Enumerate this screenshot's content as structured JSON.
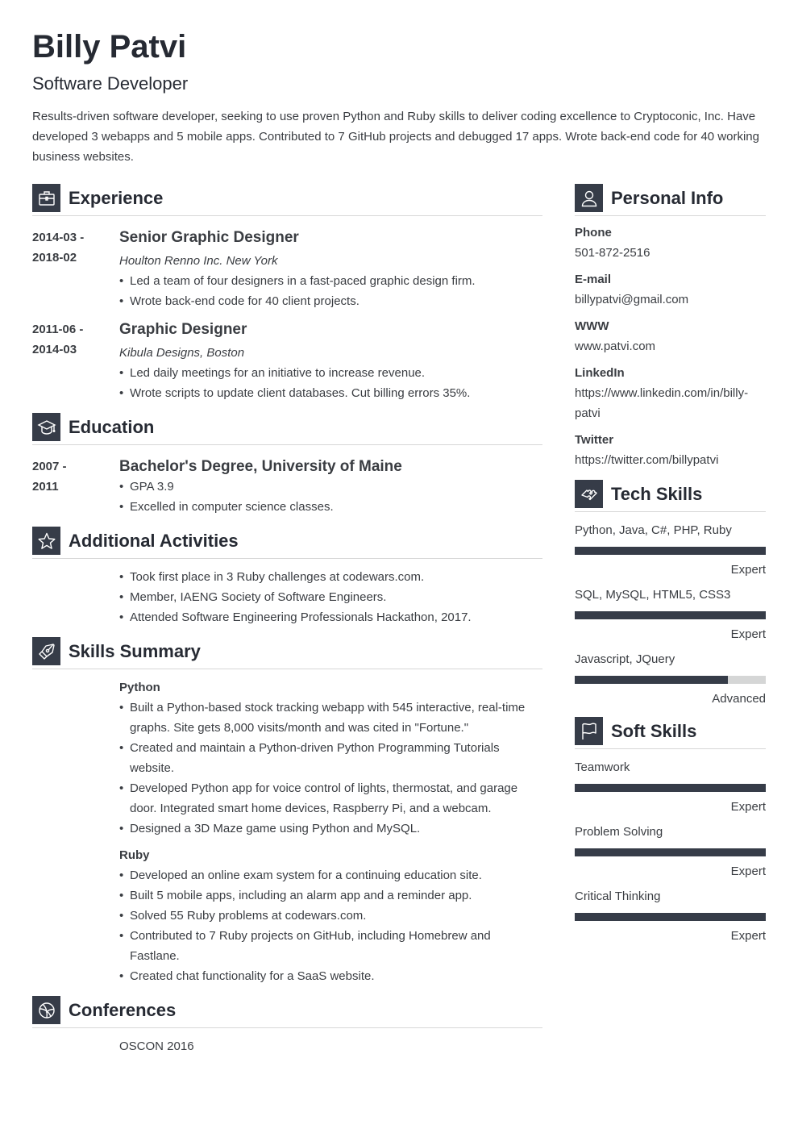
{
  "header": {
    "name": "Billy Patvi",
    "title": "Software Developer",
    "summary": "Results-driven software developer, seeking to use proven Python and Ruby skills to deliver coding excellence to Cryptoconic, Inc. Have developed 3 webapps and 5 mobile apps. Contributed to 7 GitHub projects and debugged 17 apps. Wrote back-end code for 40 working business websites."
  },
  "experience": {
    "heading": "Experience",
    "icon": "briefcase-icon",
    "entries": [
      {
        "date_start": "2014-03 -",
        "date_end": "2018-02",
        "title": "Senior Graphic Designer",
        "company": "Houlton Renno Inc. New York",
        "bullets": [
          "Led a team of four designers in a fast-paced graphic design firm.",
          "Wrote back-end code for 40 client projects."
        ]
      },
      {
        "date_start": "2011-06 -",
        "date_end": "2014-03",
        "title": "Graphic Designer",
        "company": "Kibula Designs, Boston",
        "bullets": [
          "Led daily meetings for an initiative to increase revenue.",
          "Wrote scripts to update client databases. Cut billing errors 35%."
        ]
      }
    ]
  },
  "education": {
    "heading": "Education",
    "icon": "graduation-cap-icon",
    "entries": [
      {
        "date_start": "2007 -",
        "date_end": "2011",
        "title": "Bachelor's Degree, University of Maine",
        "bullets": [
          "GPA 3.9",
          "Excelled in computer science classes."
        ]
      }
    ]
  },
  "activities": {
    "heading": "Additional Activities",
    "icon": "star-icon",
    "bullets": [
      "Took first place in 3 Ruby challenges at codewars.com.",
      "Member, IAENG Society of Software Engineers.",
      "Attended Software Engineering Professionals Hackathon, 2017."
    ]
  },
  "skills_summary": {
    "heading": "Skills Summary",
    "icon": "pen-nib-icon",
    "groups": [
      {
        "name": "Python",
        "bullets": [
          "Built a Python-based stock tracking webapp with 545 interactive, real-time graphs. Site gets 8,000 visits/month and was cited in \"Fortune.\"",
          "Created and maintain a Python-driven Python Programming Tutorials website.",
          "Developed Python app for voice control of lights, thermostat, and garage door. Integrated smart home devices, Raspberry Pi, and a webcam.",
          "Designed a 3D Maze game using Python and MySQL."
        ]
      },
      {
        "name": "Ruby",
        "bullets": [
          "Developed an online exam system for a continuing education site.",
          "Built 5 mobile apps, including an alarm app and a reminder app.",
          "Solved 55 Ruby problems at codewars.com.",
          "Contributed to 7 Ruby projects on GitHub, including Homebrew and Fastlane.",
          "Created chat functionality for a SaaS website."
        ]
      }
    ]
  },
  "conferences": {
    "heading": "Conferences",
    "icon": "basketball-icon",
    "items": [
      "OSCON 2016"
    ]
  },
  "personal_info": {
    "heading": "Personal Info",
    "icon": "user-icon",
    "fields": [
      {
        "label": "Phone",
        "value": "501-872-2516"
      },
      {
        "label": "E-mail",
        "value": "billypatvi@gmail.com"
      },
      {
        "label": "WWW",
        "value": "www.patvi.com"
      },
      {
        "label": "LinkedIn",
        "value": "https://www.linkedin.com/in/billy-patvi"
      },
      {
        "label": "Twitter",
        "value": "https://twitter.com/billypatvi"
      }
    ]
  },
  "tech_skills": {
    "heading": "Tech Skills",
    "icon": "puzzle-icon",
    "items": [
      {
        "name": "Python, Java, C#, PHP, Ruby",
        "level": "Expert",
        "fill": 1.0
      },
      {
        "name": "SQL, MySQL, HTML5, CSS3",
        "level": "Expert",
        "fill": 1.0
      },
      {
        "name": "Javascript, JQuery",
        "level": "Advanced",
        "fill": 0.8
      }
    ]
  },
  "soft_skills": {
    "heading": "Soft Skills",
    "icon": "flag-icon",
    "items": [
      {
        "name": "Teamwork",
        "level": "Expert",
        "fill": 1.0
      },
      {
        "name": "Problem Solving",
        "level": "Expert",
        "fill": 1.0
      },
      {
        "name": "Critical Thinking",
        "level": "Expert",
        "fill": 1.0
      }
    ]
  },
  "colors": {
    "accent": "#363c48",
    "bar_track": "#d5d6d6",
    "text": "#3a3d42",
    "heading": "#262a33"
  }
}
